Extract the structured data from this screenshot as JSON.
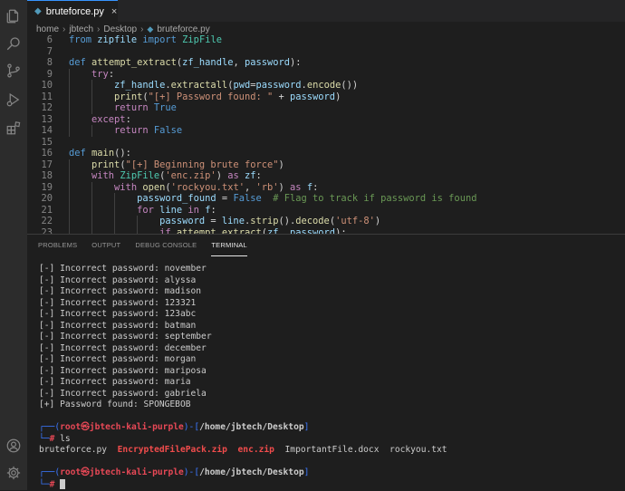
{
  "tab": {
    "label": "bruteforce.py",
    "close_glyph": "×",
    "file_icon": "python-file-icon"
  },
  "breadcrumb": {
    "items": [
      "home",
      "jbtech",
      "Desktop",
      "bruteforce.py"
    ]
  },
  "editor": {
    "line_numbers": [
      "6",
      "7",
      "8",
      "9",
      "10",
      "11",
      "12",
      "13",
      "14",
      "15",
      "16",
      "17",
      "18",
      "19",
      "20",
      "21",
      "22",
      "23"
    ],
    "lines": [
      "from zipfile import ZipFile",
      "",
      "def attempt_extract(zf_handle, password):",
      "    try:",
      "        zf_handle.extractall(pwd=password.encode())",
      "        print(\"[+] Password found: \" + password)",
      "        return True",
      "    except:",
      "        return False",
      "",
      "def main():",
      "    print(\"[+] Beginning brute force\")",
      "    with ZipFile('enc.zip') as zf:",
      "        with open('rockyou.txt', 'rb') as f:",
      "            password_found = False  # Flag to track if password is found",
      "            for line in f:",
      "                password = line.strip().decode('utf-8')",
      "                if attempt_extract(zf, password):"
    ]
  },
  "panel": {
    "tabs": [
      "PROBLEMS",
      "OUTPUT",
      "DEBUG CONSOLE",
      "TERMINAL"
    ],
    "active_tab": "TERMINAL"
  },
  "terminal": {
    "lines": [
      "[-] Incorrect password: november",
      "[-] Incorrect password: alyssa",
      "[-] Incorrect password: madison",
      "[-] Incorrect password: 123321",
      "[-] Incorrect password: 123abc",
      "[-] Incorrect password: batman",
      "[-] Incorrect password: september",
      "[-] Incorrect password: december",
      "[-] Incorrect password: morgan",
      "[-] Incorrect password: mariposa",
      "[-] Incorrect password: maria",
      "[-] Incorrect password: gabriela",
      "[+] Password found: SPONGEBOB"
    ],
    "prompt": {
      "open": "┌──(",
      "user": "root㉿jbtech-kali-purple",
      "mid": ")-[",
      "path": "/home/jbtech/Desktop",
      "close": "]",
      "hash_prefix": "└─",
      "hash": "#"
    },
    "command": "ls",
    "ls_output": [
      {
        "name": "bruteforce.py",
        "color": "#cccccc"
      },
      {
        "name": "EncryptedFilePack.zip",
        "color": "#f14c4c"
      },
      {
        "name": "enc.zip",
        "color": "#f14c4c"
      },
      {
        "name": "ImportantFile.docx",
        "color": "#cccccc"
      },
      {
        "name": "rockyou.txt",
        "color": "#cccccc"
      }
    ]
  },
  "activity_bar": {
    "icons": [
      "explorer-icon",
      "search-icon",
      "source-control-icon",
      "run-debug-icon",
      "extensions-icon",
      "account-icon",
      "settings-gear-icon"
    ]
  },
  "colors": {
    "keyword": "#569cd6",
    "control": "#c586c0",
    "function": "#dcdcaa",
    "string": "#ce9178",
    "comment": "#6a9955",
    "prompt_blue": "#3b78ff",
    "prompt_red": "#e74856"
  }
}
